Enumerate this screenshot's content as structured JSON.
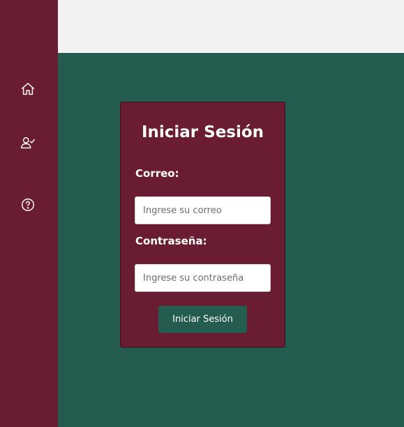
{
  "sidebar": {
    "items": [
      {
        "icon": "home-icon"
      },
      {
        "icon": "user-check-icon"
      },
      {
        "icon": "help-circle-icon"
      }
    ]
  },
  "login": {
    "title": "Iniciar Sesión",
    "email_label": "Correo:",
    "email_placeholder": "Ingrese su correo",
    "email_value": "",
    "password_label": "Contraseña:",
    "password_placeholder": "Ingrese su contraseña",
    "password_value": "",
    "submit_label": "Iniciar Sesión"
  },
  "colors": {
    "sidebar": "#691c32",
    "background": "#245c4f",
    "topbar": "#f2f2f2",
    "card": "#691c32",
    "button": "#245c4f"
  }
}
